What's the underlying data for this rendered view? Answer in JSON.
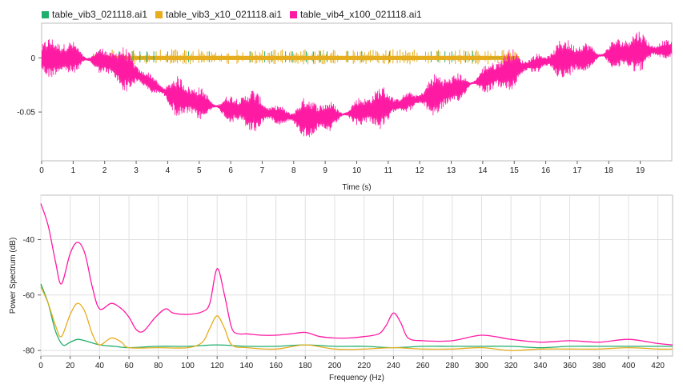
{
  "legend": [
    {
      "name": "table_vib3_021118.ai1",
      "color": "#1fae6b"
    },
    {
      "name": "table_vib3_x10_021118.ai1",
      "color": "#e6ad1e"
    },
    {
      "name": "table_vib4_x100_021118.ai1",
      "color": "#ff1aa3"
    }
  ],
  "chart_data": [
    {
      "type": "line",
      "title": "",
      "xlabel": "Time (s)",
      "ylabel": "",
      "xlim": [
        0,
        20
      ],
      "ylim": [
        -0.095,
        0.032
      ],
      "xticks": [
        0,
        1,
        2,
        3,
        4,
        5,
        6,
        7,
        8,
        9,
        10,
        11,
        12,
        13,
        14,
        15,
        16,
        17,
        18,
        19
      ],
      "yticks": [
        {
          "value": 0,
          "label": "0"
        },
        {
          "value": -0.05,
          "label": "-0.05"
        }
      ],
      "grid": false,
      "legend_position": "top-left",
      "series": [
        {
          "name": "table_vib3_021118.ai1",
          "color": "#1fae6b",
          "description": "flat near 0 with small spikes",
          "x": [
            0,
            20
          ],
          "y": [
            0,
            0
          ]
        },
        {
          "name": "table_vib3_x10_021118.ai1",
          "color": "#e6ad1e",
          "description": "flat near 0 with spikes up to +0.008 / -0.008",
          "x": [
            0,
            20
          ],
          "y": [
            0,
            0
          ]
        },
        {
          "name": "table_vib4_x100_021118.ai1",
          "color": "#ff1aa3",
          "description": "dense oscillation; baseline estimate",
          "x": [
            0,
            1,
            2,
            3,
            4,
            5,
            6,
            7,
            8,
            9,
            10,
            11,
            12,
            13,
            14,
            15,
            16,
            17,
            18,
            19,
            20
          ],
          "y": [
            0.0,
            0.0,
            -0.003,
            -0.015,
            -0.033,
            -0.042,
            -0.047,
            -0.05,
            -0.055,
            -0.055,
            -0.05,
            -0.045,
            -0.038,
            -0.03,
            -0.02,
            -0.01,
            -0.003,
            0.0,
            0.003,
            0.006,
            0.008
          ]
        }
      ]
    },
    {
      "type": "line",
      "title": "",
      "xlabel": "Frequency (Hz)",
      "ylabel": "Power Spectrum (dB)",
      "xlim": [
        0,
        430
      ],
      "ylim": [
        -82,
        -24
      ],
      "xticks": [
        0,
        20,
        40,
        60,
        80,
        100,
        120,
        140,
        160,
        180,
        200,
        220,
        240,
        260,
        280,
        300,
        320,
        340,
        360,
        380,
        400,
        420
      ],
      "yticks": [
        {
          "value": -40,
          "label": "-40"
        },
        {
          "value": -60,
          "label": "-60"
        },
        {
          "value": -80,
          "label": "-80"
        }
      ],
      "grid": true,
      "series": [
        {
          "name": "table_vib3_021118.ai1",
          "color": "#1fae6b",
          "x": [
            0,
            5,
            10,
            15,
            20,
            25,
            30,
            40,
            50,
            60,
            80,
            100,
            120,
            140,
            160,
            180,
            200,
            220,
            240,
            260,
            280,
            300,
            320,
            340,
            360,
            380,
            400,
            420,
            430
          ],
          "y": [
            -56,
            -63,
            -73,
            -78,
            -77,
            -76,
            -76.5,
            -78,
            -78.5,
            -79,
            -78.5,
            -78.5,
            -78,
            -78.5,
            -78.5,
            -78,
            -78.5,
            -78.5,
            -79,
            -78.5,
            -78.5,
            -78.5,
            -78.5,
            -79,
            -78.5,
            -78.5,
            -78.5,
            -78.5,
            -78.5
          ]
        },
        {
          "name": "table_vib3_x10_021118.ai1",
          "color": "#e6ad1e",
          "x": [
            0,
            5,
            10,
            14,
            20,
            25,
            30,
            35,
            40,
            48,
            55,
            60,
            80,
            100,
            110,
            115,
            120,
            125,
            130,
            140,
            160,
            180,
            200,
            220,
            240,
            260,
            280,
            300,
            320,
            340,
            360,
            380,
            400,
            420,
            430
          ],
          "y": [
            -57,
            -63,
            -71,
            -75,
            -67,
            -63,
            -66,
            -74,
            -78,
            -75.5,
            -77,
            -79,
            -79,
            -79,
            -77,
            -72,
            -67.5,
            -72,
            -78,
            -79,
            -79.5,
            -78,
            -79.5,
            -79.5,
            -79,
            -79.5,
            -79.5,
            -79,
            -80,
            -79.5,
            -79.5,
            -79.5,
            -79,
            -79.5,
            -79.5
          ]
        },
        {
          "name": "table_vib4_x100_021118.ai1",
          "color": "#ff1aa3",
          "x": [
            0,
            5,
            10,
            14,
            20,
            25,
            30,
            35,
            40,
            48,
            55,
            60,
            65,
            70,
            78,
            85,
            90,
            100,
            110,
            115,
            120,
            125,
            130,
            135,
            140,
            150,
            160,
            170,
            180,
            190,
            200,
            210,
            220,
            230,
            235,
            240,
            245,
            250,
            260,
            280,
            300,
            320,
            340,
            360,
            380,
            400,
            420,
            430
          ],
          "y": [
            -27,
            -35,
            -48,
            -56,
            -45,
            -41,
            -45,
            -57,
            -65,
            -63,
            -65,
            -68,
            -72.5,
            -73,
            -68,
            -65,
            -66.5,
            -67,
            -66,
            -63,
            -50.5,
            -60,
            -72,
            -74,
            -74,
            -74.5,
            -74.5,
            -74,
            -73.5,
            -75,
            -75.5,
            -75.5,
            -75,
            -74,
            -71,
            -66.5,
            -70,
            -75.5,
            -76.5,
            -76.5,
            -74.5,
            -76,
            -77,
            -76.5,
            -77,
            -76,
            -77.5,
            -78
          ]
        }
      ]
    }
  ]
}
